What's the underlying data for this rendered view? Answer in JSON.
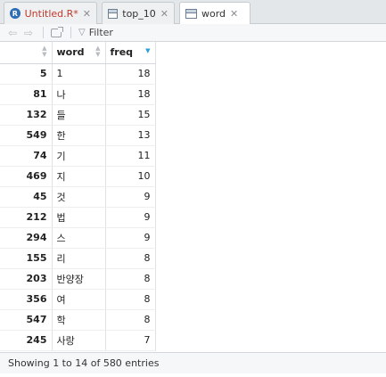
{
  "tabs": [
    {
      "label": "Untitled.R*",
      "icon": "r-script-icon",
      "active": false,
      "unsaved": true
    },
    {
      "label": "top_10",
      "icon": "table-icon",
      "active": false
    },
    {
      "label": "word",
      "icon": "table-icon",
      "active": true
    }
  ],
  "toolbar": {
    "filter_label": "Filter"
  },
  "table": {
    "columns": [
      {
        "label": ""
      },
      {
        "label": "word"
      },
      {
        "label": "freq",
        "sorted": "descending"
      }
    ],
    "rows": [
      {
        "id": "5",
        "word": "1",
        "freq": "18"
      },
      {
        "id": "81",
        "word": "나",
        "freq": "18"
      },
      {
        "id": "132",
        "word": "들",
        "freq": "15"
      },
      {
        "id": "549",
        "word": "한",
        "freq": "13"
      },
      {
        "id": "74",
        "word": "기",
        "freq": "11"
      },
      {
        "id": "469",
        "word": "지",
        "freq": "10"
      },
      {
        "id": "45",
        "word": "것",
        "freq": "9"
      },
      {
        "id": "212",
        "word": "법",
        "freq": "9"
      },
      {
        "id": "294",
        "word": "스",
        "freq": "9"
      },
      {
        "id": "155",
        "word": "리",
        "freq": "8"
      },
      {
        "id": "203",
        "word": "반양장",
        "freq": "8"
      },
      {
        "id": "356",
        "word": "여",
        "freq": "8"
      },
      {
        "id": "547",
        "word": "학",
        "freq": "8"
      },
      {
        "id": "245",
        "word": "사랑",
        "freq": "7"
      }
    ]
  },
  "status": {
    "text": "Showing 1 to 14 of 580 entries"
  }
}
